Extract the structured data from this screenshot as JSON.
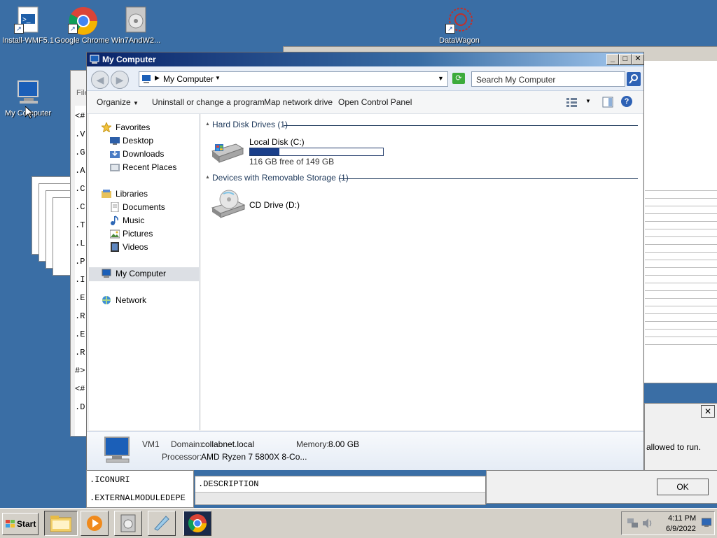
{
  "desktop": {
    "icons": [
      {
        "label": "Install-WMF5.1"
      },
      {
        "label": "Google Chrome"
      },
      {
        "label": "Win7AndW2..."
      },
      {
        "label": "DataWagon"
      },
      {
        "label": "My Computer"
      }
    ]
  },
  "bg_console": {
    "menu_label": "File",
    "lines": [
      "<#",
      ".V",
      ".G",
      ".A",
      ".C",
      ".C",
      ".T",
      ".L",
      ".P",
      ".I",
      ".E",
      ".R",
      ".E",
      ".R",
      "#>",
      "<#",
      ".D"
    ]
  },
  "bg_bottom": {
    "left_text": ".ICONURI",
    "left_text2": ".EXTERNALMODULEDEPE",
    "mid_text": ".DESCRIPTION"
  },
  "dialog": {
    "message": "allowed to run.",
    "ok_label": "OK"
  },
  "window": {
    "title": "My Computer",
    "address": "My Computer",
    "search_placeholder": "Search My Computer",
    "toolbar": {
      "organize": "Organize",
      "uninstall": "Uninstall or change a program",
      "map_drive": "Map network drive",
      "control_panel": "Open Control Panel"
    },
    "nav": {
      "favorites": "Favorites",
      "desktop": "Desktop",
      "downloads": "Downloads",
      "recent_places": "Recent Places",
      "libraries": "Libraries",
      "documents": "Documents",
      "music": "Music",
      "pictures": "Pictures",
      "videos": "Videos",
      "my_computer": "My Computer",
      "network": "Network"
    },
    "groups": {
      "hdd_title": "Hard Disk Drives (1)",
      "removable_title": "Devices with Removable Storage (1)"
    },
    "drives": {
      "local_disk_name": "Local Disk (C:)",
      "local_disk_free": "116 GB free of 149 GB",
      "local_disk_used_fraction": 0.22,
      "cd_drive_name": "CD Drive (D:)"
    },
    "details": {
      "computer_name": "VM1",
      "domain_label": "Domain:",
      "domain_value": "collabnet.local",
      "memory_label": "Memory:",
      "memory_value": "8.00 GB",
      "processor_label": "Processor:",
      "processor_value": "AMD Ryzen 7 5800X 8-Co..."
    }
  },
  "taskbar": {
    "start_label": "Start",
    "time": "4:11 PM",
    "date": "6/9/2022"
  },
  "colors": {
    "desktop_bg": "#3a6ea5",
    "title_bar": "#0a246a",
    "disk_bar": "#1a3f8a"
  }
}
